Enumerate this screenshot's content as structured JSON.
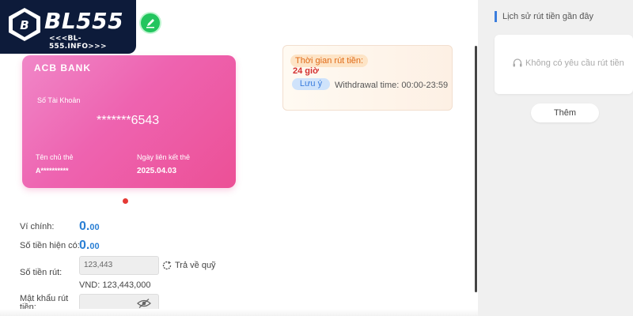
{
  "logo": {
    "name": "BL555",
    "subtitle": "<<<BL-555.INFO>>>"
  },
  "card": {
    "bank_name": "ACB BANK",
    "account_label": "Số Tài Khoản",
    "account_number": "*******6543",
    "holder_label": "Tên chủ thẻ",
    "holder_value": "A**********",
    "link_date_label": "Ngày liên kết thẻ",
    "link_date_value": "2025.04.03"
  },
  "notice": {
    "time_label": "Thời gian rút tiền:",
    "time_value": "24 giờ",
    "note_tag": "Lưu ý",
    "note_text": "Withdrawal time: 00:00-23:59"
  },
  "form": {
    "main_wallet_label": "Ví chính:",
    "main_wallet_int": "0.",
    "main_wallet_dec": "00",
    "available_label": "Số tiền hiện có:",
    "available_int": "0.",
    "available_dec": "00",
    "withdraw_label": "Số tiền rút:",
    "withdraw_value": "123,443",
    "refresh_label": "Trả về quỹ",
    "vnd_text": "VND: 123,443,000",
    "password_label": "Mật khẩu rút tiền:"
  },
  "history": {
    "title": "Lịch sử rút tiền gần đây",
    "empty_text": "Không có yêu cầu rút tiền",
    "more_button": "Thêm"
  },
  "colors": {
    "accent_green": "#22c55e",
    "card_pink": "#ec5096",
    "amount_blue": "#2a7fd4",
    "notice_orange": "#e06a16",
    "notice_red": "#d32f2f",
    "title_bar_blue": "#3b7ddd"
  },
  "icons": {
    "edit": "pencil-icon",
    "refresh": "refresh-icon",
    "password_toggle": "eye-icon",
    "empty_history": "headset-icon"
  }
}
